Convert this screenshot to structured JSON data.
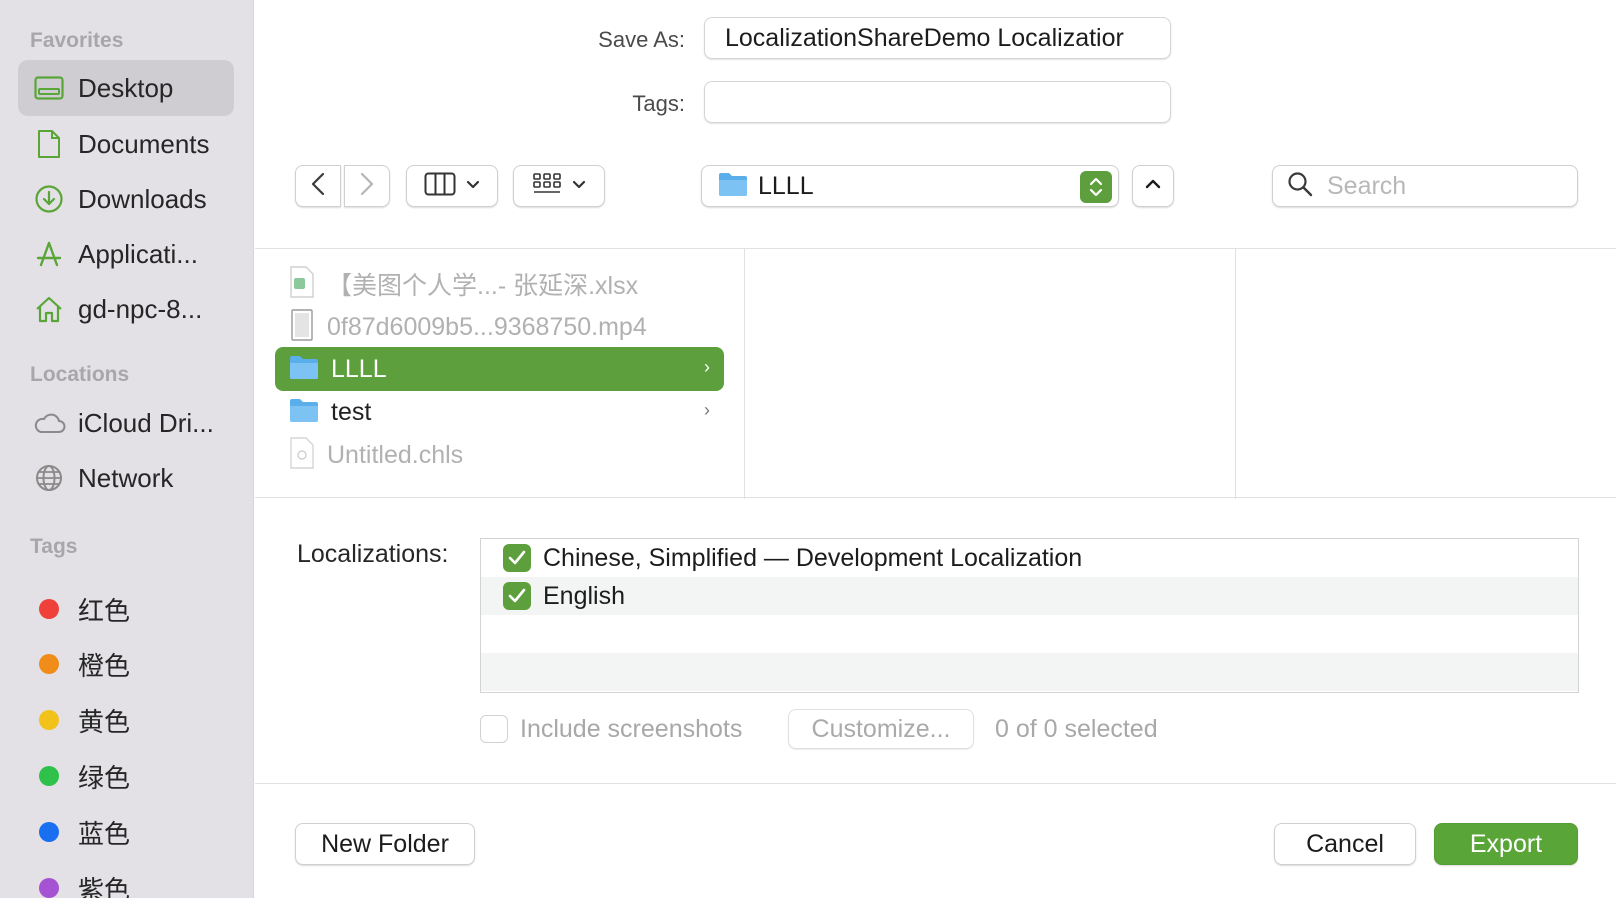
{
  "sidebar": {
    "favorites_title": "Favorites",
    "locations_title": "Locations",
    "tags_title": "Tags",
    "favorites": [
      {
        "label": "Desktop",
        "icon": "desktop-icon",
        "selected": true
      },
      {
        "label": "Documents",
        "icon": "document-icon"
      },
      {
        "label": "Downloads",
        "icon": "downloads-icon"
      },
      {
        "label": "Applicati...",
        "icon": "applications-icon"
      },
      {
        "label": "gd-npc-8...",
        "icon": "home-icon"
      }
    ],
    "locations": [
      {
        "label": "iCloud Dri...",
        "icon": "cloud-icon"
      },
      {
        "label": "Network",
        "icon": "network-icon"
      }
    ],
    "tags": [
      {
        "label": "红色",
        "color": "#f0403a"
      },
      {
        "label": "橙色",
        "color": "#f08c1a"
      },
      {
        "label": "黄色",
        "color": "#f2c21b"
      },
      {
        "label": "绿色",
        "color": "#2fc24b"
      },
      {
        "label": "蓝色",
        "color": "#1a6ff0"
      },
      {
        "label": "紫色",
        "color": "#a552d3"
      }
    ]
  },
  "form": {
    "save_as_label": "Save As:",
    "save_as_value": "LocalizationShareDemo Localizatior",
    "tags_label": "Tags:",
    "tags_value": ""
  },
  "toolbar": {
    "location_name": "LLLL",
    "search_placeholder": "Search"
  },
  "files": [
    {
      "name": "【美图个人学...- 张延深.xlsx",
      "type": "spreadsheet",
      "dim": true
    },
    {
      "name": "0f87d6009b5...9368750.mp4",
      "type": "video",
      "dim": true
    },
    {
      "name": "LLLL",
      "type": "folder",
      "selected": true
    },
    {
      "name": "test",
      "type": "folder"
    },
    {
      "name": "Untitled.chls",
      "type": "document",
      "dim": true
    }
  ],
  "localizations": {
    "label": "Localizations:",
    "items": [
      {
        "label": "Chinese, Simplified — Development Localization",
        "checked": true
      },
      {
        "label": "English",
        "checked": true
      }
    ]
  },
  "options": {
    "include_screenshots": "Include screenshots",
    "customize": "Customize...",
    "selected_count": "0 of 0 selected"
  },
  "footer": {
    "new_folder": "New Folder",
    "cancel": "Cancel",
    "export": "Export"
  },
  "colors": {
    "accent": "#5e9f3d",
    "sidebar_bg": "#e3e1e6",
    "sidebar_icon": "#5aa538"
  }
}
